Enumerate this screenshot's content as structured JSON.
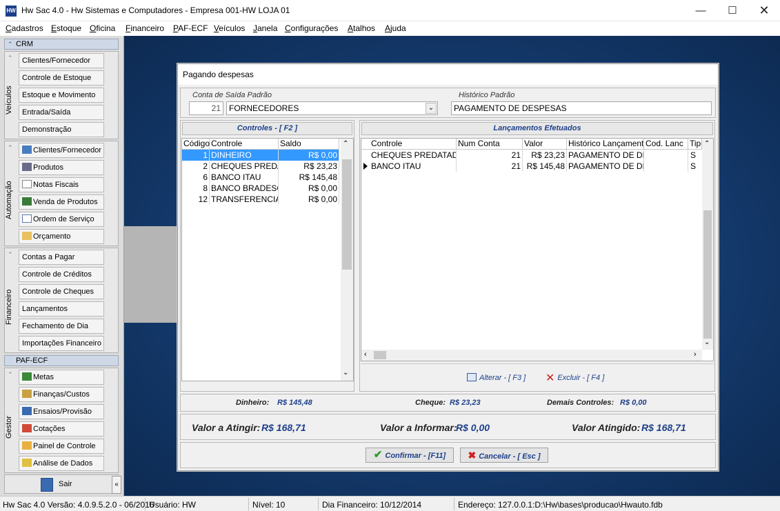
{
  "window": {
    "title": "Hw Sac 4.0 - Hw Sistemas e Computadores - Empresa 001-HW LOJA 01",
    "app_icon": "HW"
  },
  "menu": [
    "Cadastros",
    "Estoque",
    "Oficina",
    "Financeiro",
    "PAF-ECF",
    "Veículos",
    "Janela",
    "Configurações",
    "Atalhos",
    "Ajuda"
  ],
  "sidebar": {
    "crm_header": "CRM",
    "veiculos": {
      "label": "Veículos",
      "items": [
        "Clientes/Fornecedor",
        "Controle de Estoque",
        "Estoque e Movimento",
        "Entrada/Saída",
        "Demonstração"
      ]
    },
    "automacao": {
      "label": "Automação",
      "items": [
        "Clientes/Fornecedor",
        "Produtos",
        "Notas Fiscais",
        "Venda de Produtos",
        "Ordem de Serviço",
        "Orçamento"
      ]
    },
    "financeiro": {
      "label": "Financeiro",
      "items": [
        "Contas a Pagar",
        "Controle de Créditos",
        "Controle de Cheques",
        "Lançamentos",
        "Fechamento de Dia",
        "Importações Financeiro"
      ]
    },
    "paf_header": "PAF-ECF",
    "gestor": {
      "label": "Gestor",
      "items": [
        "Metas",
        "Finanças/Custos",
        "Ensaios/Provisão",
        "Cotações",
        "Painel de Controle",
        "Análise de Dados"
      ]
    },
    "sair": "Sair",
    "collapse": "«"
  },
  "dialog": {
    "title": "Pagando despesas",
    "conta_label": "Conta de Saída Padrão",
    "conta_code": "21",
    "conta_value": "FORNECEDORES",
    "historico_label": "Histórico Padrão",
    "historico_value": "PAGAMENTO DE DESPESAS",
    "controles": {
      "header": "Controles - [ F2 ]",
      "columns": [
        "Código",
        "Controle",
        "Saldo"
      ],
      "rows": [
        {
          "codigo": "1",
          "controle": "DINHEIRO",
          "saldo": "R$ 0,00"
        },
        {
          "codigo": "2",
          "controle": "CHEQUES PREDAT",
          "saldo": "R$ 23,23"
        },
        {
          "codigo": "6",
          "controle": "BANCO ITAU",
          "saldo": "R$ 145,48"
        },
        {
          "codigo": "8",
          "controle": "BANCO BRADESCO",
          "saldo": "R$ 0,00"
        },
        {
          "codigo": "12",
          "controle": "TRANSFERENCIAS",
          "saldo": "R$ 0,00"
        }
      ]
    },
    "lancamentos": {
      "header": "Lançamentos Efetuados",
      "columns": [
        "Controle",
        "Num Conta",
        "Valor",
        "Histórico Lançamento",
        "Cod. Lanc",
        "Tipo"
      ],
      "rows": [
        {
          "controle": "CHEQUES PREDATADO",
          "num_conta": "21",
          "valor": "R$ 23,23",
          "historico": "PAGAMENTO DE DESPESAS",
          "cod": "",
          "tipo": "S"
        },
        {
          "controle": "BANCO ITAU",
          "num_conta": "21",
          "valor": "R$ 145,48",
          "historico": "PAGAMENTO DE DESPESAS",
          "cod": "",
          "tipo": "S"
        }
      ],
      "alterar": "Alterar - [ F3 ]",
      "excluir": "Excluir - [ F4 ]"
    },
    "totals": {
      "dinheiro_label": "Dinheiro:",
      "dinheiro_value": "R$ 145,48",
      "cheque_label": "Cheque:",
      "cheque_value": "R$ 23,23",
      "demais_label": "Demais Controles:",
      "demais_value": "R$ 0,00"
    },
    "summary": {
      "atingir_label": "Valor a Atingir:",
      "atingir_value": "R$ 168,71",
      "informar_label": "Valor a Informar:",
      "informar_value": "R$ 0,00",
      "atingido_label": "Valor Atingido:",
      "atingido_value": "R$ 168,71"
    },
    "confirmar": "Confirmar - [F11]",
    "cancelar": "Cancelar - [ Esc ]"
  },
  "status": {
    "version": "Hw Sac 4.0 Versão: 4.0.9.5.2.0 - 06/2016",
    "usuario": "Usuário: HW",
    "nivel": "Nível: 10",
    "dia": "Dia Financeiro: 10/12/2014",
    "endereco": "Endereço: 127.0.0.1:D:\\Hw\\bases\\producao\\Hwauto.fdb"
  },
  "colors": {
    "accent": "#1d3f8a",
    "desktop": "#143a6d",
    "selection": "#3399ff"
  }
}
